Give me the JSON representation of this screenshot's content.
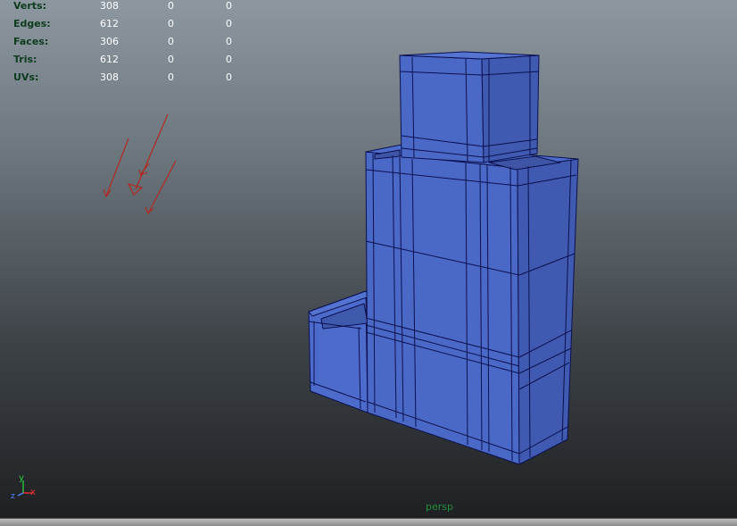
{
  "hud": {
    "rows": [
      {
        "label": "Verts:",
        "v1": "308",
        "v2": "0",
        "v3": "0"
      },
      {
        "label": "Edges:",
        "v1": "612",
        "v2": "0",
        "v3": "0"
      },
      {
        "label": "Faces:",
        "v1": "306",
        "v2": "0",
        "v3": "0"
      },
      {
        "label": "Tris:",
        "v1": "612",
        "v2": "0",
        "v3": "0"
      },
      {
        "label": "UVs:",
        "v1": "308",
        "v2": "0",
        "v3": "0"
      }
    ]
  },
  "camera_name": "persp",
  "axis": {
    "x": "x",
    "y": "y",
    "z": "z"
  },
  "colors": {
    "mesh_fill": "#4a68c6",
    "mesh_side": "#3e58a8",
    "mesh_edge": "#0b1150",
    "light_arrows": "#b02a22",
    "hud_label": "#0d3b1e"
  }
}
